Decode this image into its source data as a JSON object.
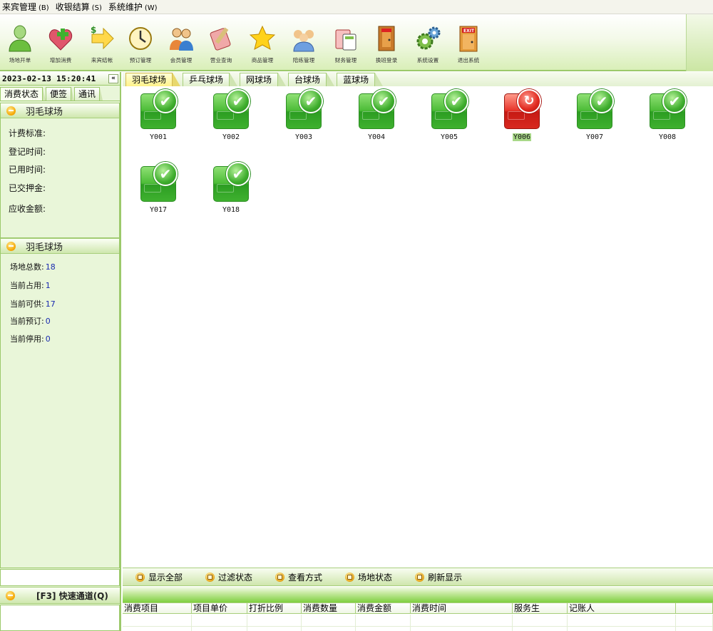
{
  "menu": [
    {
      "label": "来宾管理",
      "hotkey": "(B)"
    },
    {
      "label": "收银结算",
      "hotkey": "(S)"
    },
    {
      "label": "系统维护",
      "hotkey": "(W)"
    }
  ],
  "toolbar": [
    {
      "label": "场地开单",
      "icon": "person-icon"
    },
    {
      "label": "增加消费",
      "icon": "add-consumption-icon"
    },
    {
      "label": "来宾结帐",
      "icon": "checkout-arrow-icon"
    },
    {
      "label": "预订管理",
      "icon": "clock-icon"
    },
    {
      "label": "会员管理",
      "icon": "members-icon"
    },
    {
      "label": "营业查询",
      "icon": "query-icon"
    },
    {
      "label": "商品管理",
      "icon": "star-icon"
    },
    {
      "label": "陪练管理",
      "icon": "coaches-icon"
    },
    {
      "label": "财务管理",
      "icon": "finance-icon"
    },
    {
      "label": "换班登录",
      "icon": "shift-door-icon"
    },
    {
      "label": "系统设置",
      "icon": "gears-icon"
    },
    {
      "label": "退出系统",
      "icon": "exit-door-icon"
    }
  ],
  "left": {
    "datetime": "2023-02-13 15:20:41",
    "collapse": "«",
    "tabs": [
      "消费状态",
      "便签",
      "通讯"
    ],
    "info": {
      "title": "羽毛球场",
      "fields": [
        "计费标准:",
        "登记时间:",
        "已用时间:",
        "已交押金:",
        "应收金额:"
      ]
    },
    "stats": {
      "title": "羽毛球场",
      "rows": [
        {
          "label": "场地总数:",
          "value": "18"
        },
        {
          "label": "当前占用:",
          "value": "1"
        },
        {
          "label": "当前可供:",
          "value": "17"
        },
        {
          "label": "当前预订:",
          "value": "0"
        },
        {
          "label": "当前停用:",
          "value": "0"
        }
      ]
    },
    "quick": "[F3] 快速通道(Q)"
  },
  "main": {
    "tabs": [
      "羽毛球场",
      "乒乓球场",
      "网球场",
      "台球场",
      "蓝球场"
    ],
    "active_tab": 0,
    "courts": [
      {
        "name": "Y001",
        "status": "available"
      },
      {
        "name": "Y002",
        "status": "available"
      },
      {
        "name": "Y003",
        "status": "available"
      },
      {
        "name": "Y004",
        "status": "available"
      },
      {
        "name": "Y005",
        "status": "available"
      },
      {
        "name": "Y006",
        "status": "occupied"
      },
      {
        "name": "Y007",
        "status": "available"
      },
      {
        "name": "Y008",
        "status": "available"
      },
      {
        "name": "Y017",
        "status": "available"
      },
      {
        "name": "Y018",
        "status": "available"
      }
    ],
    "bottom_tools": [
      "显示全部",
      "过滤状态",
      "查看方式",
      "场地状态",
      "刷新显示"
    ],
    "grid_columns": [
      "消费项目",
      "项目单价",
      "打折比例",
      "消费数量",
      "消费金额",
      "消费时间",
      "服务生",
      "记账人",
      ""
    ]
  },
  "colors": {
    "accent_green": "#9cc96b",
    "available": "#3fb12f",
    "occupied": "#d8281f"
  }
}
